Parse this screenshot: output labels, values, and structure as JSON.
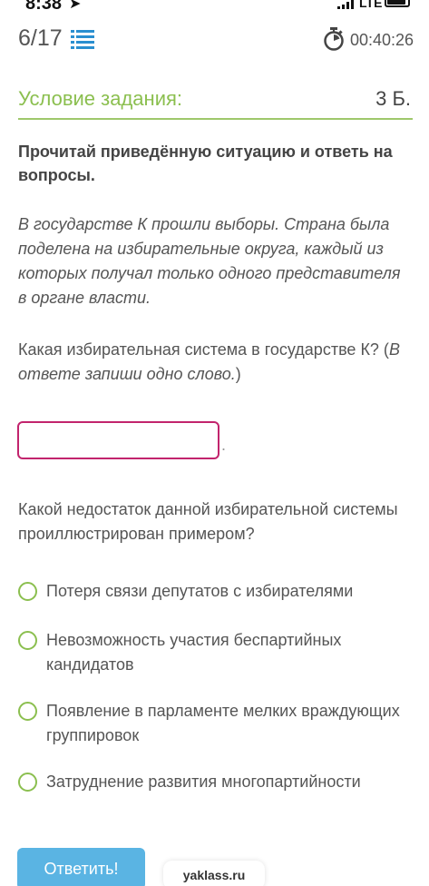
{
  "status": {
    "time": "8:38",
    "network": "LTE"
  },
  "header": {
    "counter": "6/17",
    "timer": "00:40:26"
  },
  "task": {
    "title": "Условие задания:",
    "points": "3 Б.",
    "instruction": "Прочитай приведённую ситуацию и ответь на вопросы.",
    "scenario": "В государстве К прошли выборы. Страна была поделена на избирательные округа, каждый из которых получал только одного представителя в органе власти.",
    "question1": "Какая избирательная система в государстве К? (",
    "question1_hint": "В ответе запиши одно слово.",
    "question1_close": ")",
    "answer_value": "",
    "answer_suffix": ".",
    "question2": "Какой недостаток данной избирательной системы проиллюстрирован примером?",
    "options": [
      "Потеря связи депутатов с избирателями",
      "Невозможность участия беспартийных кандидатов",
      "Появление в парламенте мелких враждующих группировок",
      "Затруднение развития многопартийности"
    ]
  },
  "footer": {
    "submit_label": "Ответить!",
    "site": "yaklass.ru"
  },
  "colors": {
    "accent_green": "#8bbf4f",
    "input_border": "#c2246d",
    "button_blue": "#5ab4e3"
  },
  "icons": [
    "arrow-icon",
    "signal-icon",
    "battery-icon",
    "list-icon",
    "timer-icon"
  ]
}
